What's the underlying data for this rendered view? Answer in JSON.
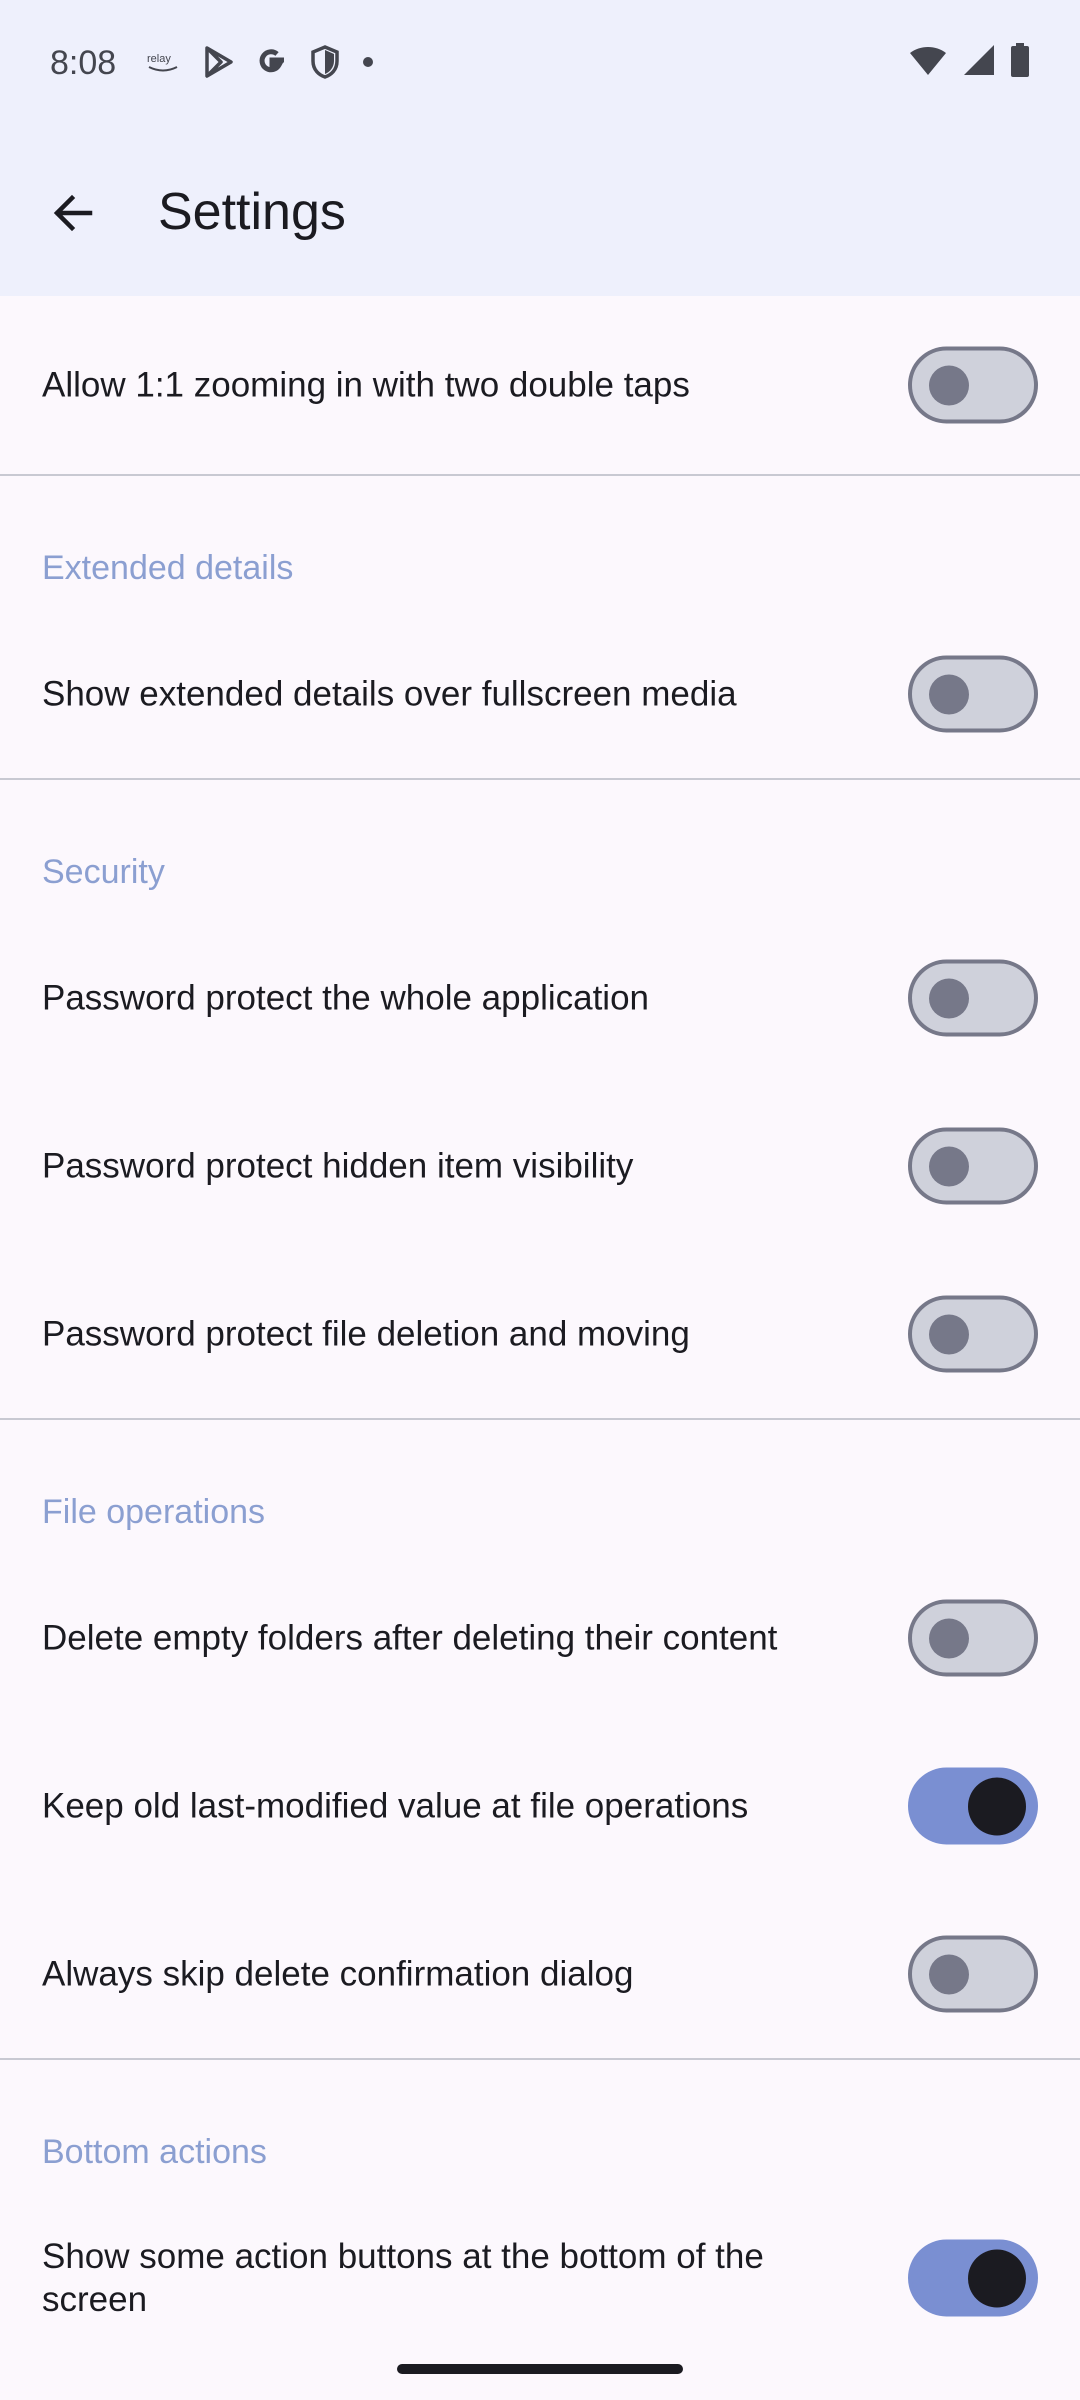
{
  "status_bar": {
    "time": "8:08",
    "left_icons": [
      "relay-icon",
      "play-store-icon",
      "google-icon",
      "shield-icon",
      "dot-icon"
    ],
    "right_icons": [
      "wifi-icon",
      "signal-icon",
      "battery-icon"
    ]
  },
  "app_bar": {
    "title": "Settings",
    "back_icon": "arrow-back-icon"
  },
  "rows_top": [
    {
      "label": "Allow 1:1 zooming in with two double taps",
      "checked": false
    }
  ],
  "sections": [
    {
      "title": "Extended details",
      "items": [
        {
          "label": "Show extended details over fullscreen media",
          "checked": false
        }
      ]
    },
    {
      "title": "Security",
      "items": [
        {
          "label": "Password protect the whole application",
          "checked": false
        },
        {
          "label": "Password protect hidden item visibility",
          "checked": false
        },
        {
          "label": "Password protect file deletion and moving",
          "checked": false
        }
      ]
    },
    {
      "title": "File operations",
      "items": [
        {
          "label": "Delete empty folders after deleting their content",
          "checked": false
        },
        {
          "label": "Keep old last-modified value at file operations",
          "checked": true
        },
        {
          "label": "Always skip delete confirmation dialog",
          "checked": false
        }
      ]
    },
    {
      "title": "Bottom actions",
      "items": [
        {
          "label": "Show some action buttons at the bottom of the screen",
          "checked": true
        }
      ]
    }
  ],
  "colors": {
    "app_bar_bg": "#eef0fc",
    "section_header": "#8b9fd1",
    "switch_on": "#7a8fd2",
    "switch_off_track": "#cfd1db"
  }
}
